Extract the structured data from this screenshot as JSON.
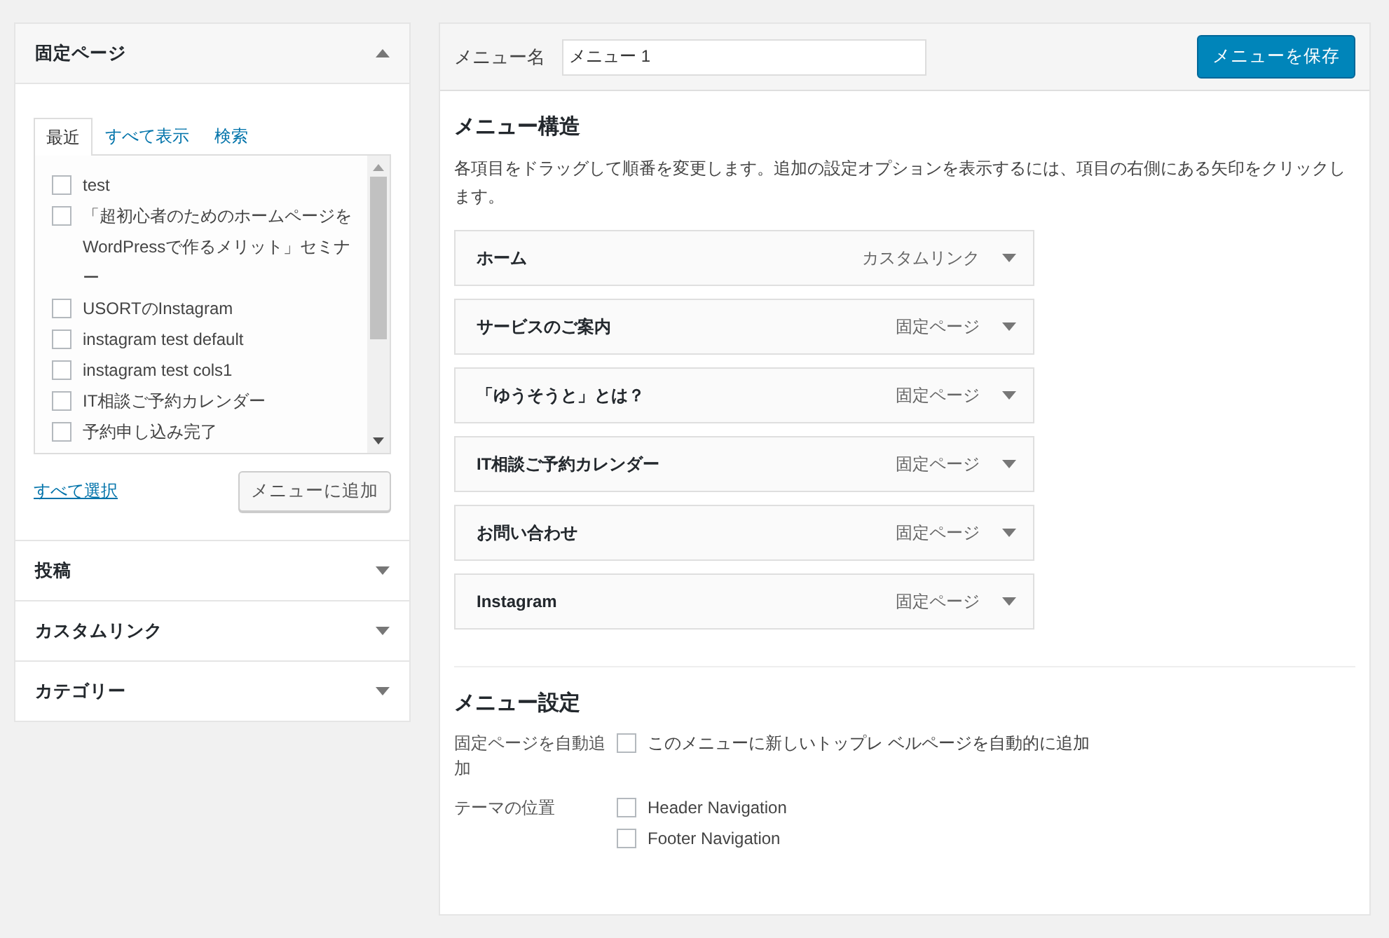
{
  "sidebar": {
    "sections": [
      {
        "title": "固定ページ",
        "expanded": true
      },
      {
        "title": "投稿",
        "expanded": false
      },
      {
        "title": "カスタムリンク",
        "expanded": false
      },
      {
        "title": "カテゴリー",
        "expanded": false
      }
    ],
    "tabs": [
      {
        "label": "最近",
        "selected": true
      },
      {
        "label": "すべて表示",
        "selected": false
      },
      {
        "label": "検索",
        "selected": false
      }
    ],
    "pages": [
      {
        "label": "test",
        "checked": false
      },
      {
        "label": "「超初心者のためのホームページをWordPressで作るメリット」セミナー",
        "checked": false
      },
      {
        "label": "USORTのInstagram",
        "checked": false
      },
      {
        "label": "instagram test default",
        "checked": false
      },
      {
        "label": "instagram test cols1",
        "checked": false
      },
      {
        "label": "IT相談ご予約カレンダー",
        "checked": false
      },
      {
        "label": "予約申し込み完了",
        "checked": false
      }
    ],
    "select_all": "すべて選択",
    "add_button": "メニューに追加"
  },
  "menu_name": {
    "label": "メニュー名",
    "value": "メニュー 1"
  },
  "save_button": "メニューを保存",
  "structure": {
    "title": "メニュー構造",
    "description": "各項目をドラッグして順番を変更します。追加の設定オプションを表示するには、項目の右側にある矢印をクリックします。",
    "items": [
      {
        "title": "ホーム",
        "type": "カスタムリンク"
      },
      {
        "title": "サービスのご案内",
        "type": "固定ページ"
      },
      {
        "title": "「ゆうそうと」とは？",
        "type": "固定ページ"
      },
      {
        "title": "IT相談ご予約カレンダー",
        "type": "固定ページ"
      },
      {
        "title": "お問い合わせ",
        "type": "固定ページ"
      },
      {
        "title": "Instagram",
        "type": "固定ページ"
      }
    ]
  },
  "settings": {
    "title": "メニュー設定",
    "auto_add": {
      "label": "固定ページを自動追加",
      "option": "このメニューに新しいトップレ ベルページを自動的に追加",
      "checked": false
    },
    "locations": {
      "label": "テーマの位置",
      "options": [
        {
          "label": "Header Navigation",
          "checked": false
        },
        {
          "label": "Footer Navigation",
          "checked": false
        }
      ]
    }
  }
}
